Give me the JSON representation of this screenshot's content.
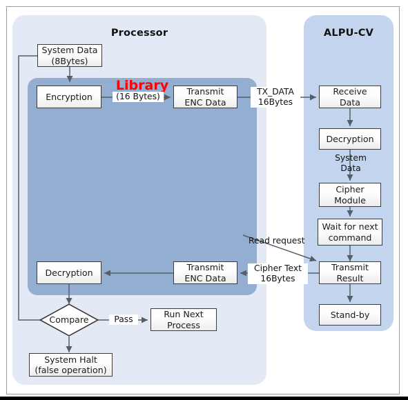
{
  "diagram": {
    "panels": {
      "processor": {
        "title": "Processor"
      },
      "library": {
        "title": "Library",
        "color": "#ff0000"
      },
      "alpu": {
        "title": "ALPU-CV"
      }
    },
    "nodes": {
      "system_data": "System Data\n(8Bytes)",
      "encryption": "Encryption",
      "transmit_enc_data_top": "Transmit\nENC Data",
      "decryption_left": "Decryption",
      "transmit_enc_data_bottom": "Transmit\nENC Data",
      "compare": "Compare",
      "run_next_process": "Run Next\nProcess",
      "system_halt": "System Halt\n(false operation)",
      "receive_data": "Receive\nData",
      "decryption_right": "Decryption",
      "cipher_module": "Cipher\nModule",
      "wait_for_next_command": "Wait for next\ncommand",
      "transmit_result": "Transmit\nResult",
      "stand_by": "Stand-by"
    },
    "edge_labels": {
      "sixteen_bytes": "(16 Bytes)",
      "tx_data": "TX_DATA\n16Bytes",
      "system_data_right": "System\nData",
      "read_request": "Read request",
      "cipher_text": "Cipher Text\n16Bytes",
      "pass": "Pass"
    }
  }
}
